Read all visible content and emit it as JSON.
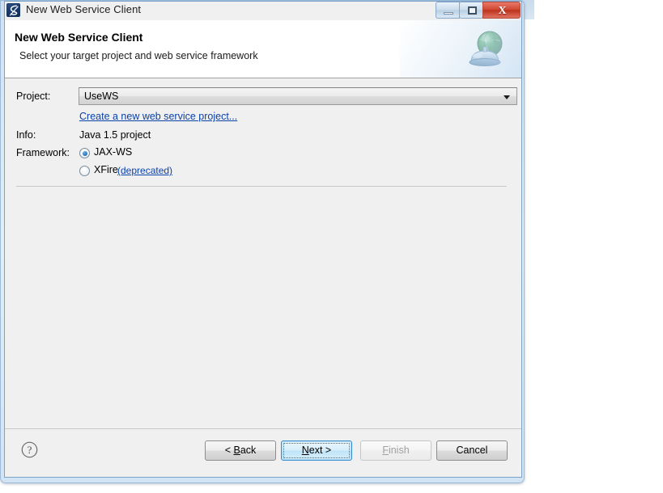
{
  "window": {
    "title": "New Web Service Client",
    "icon": "myeclipse-logo-icon",
    "controls": {
      "minimize_label": "",
      "maximize_label": "",
      "close_label": "X"
    }
  },
  "wizard_header": {
    "title": "New Web Service Client",
    "description": "Select your target project and web service framework",
    "icon": "web-service-globe-icon"
  },
  "form": {
    "project": {
      "label": "Project:",
      "value": "UseWS",
      "options": [
        "UseWS"
      ]
    },
    "new_project_link": "Create a new web service project...",
    "info": {
      "label": "Info:",
      "value": "Java 1.5 project"
    },
    "framework": {
      "label": "Framework:",
      "options": [
        {
          "label": "JAX-WS",
          "selected": true,
          "suffix": ""
        },
        {
          "label": "XFire",
          "selected": false,
          "suffix": "(deprecated)"
        }
      ]
    }
  },
  "buttons": {
    "help": "?",
    "back": {
      "prefix": "< ",
      "mnemonic": "B",
      "rest": "ack",
      "enabled": true
    },
    "next": {
      "prefix": "",
      "mnemonic": "N",
      "rest": "ext >",
      "enabled": true,
      "focused": true
    },
    "finish": {
      "prefix": "",
      "mnemonic": "F",
      "rest": "inish",
      "enabled": false
    },
    "cancel": {
      "label": "Cancel",
      "enabled": true
    }
  },
  "colors": {
    "link": "#0b42a8",
    "accent": "#3c8fd0",
    "close_button": "#bb331d",
    "dialog_bg": "#f0f0f0",
    "header_bg": "#ffffff"
  }
}
